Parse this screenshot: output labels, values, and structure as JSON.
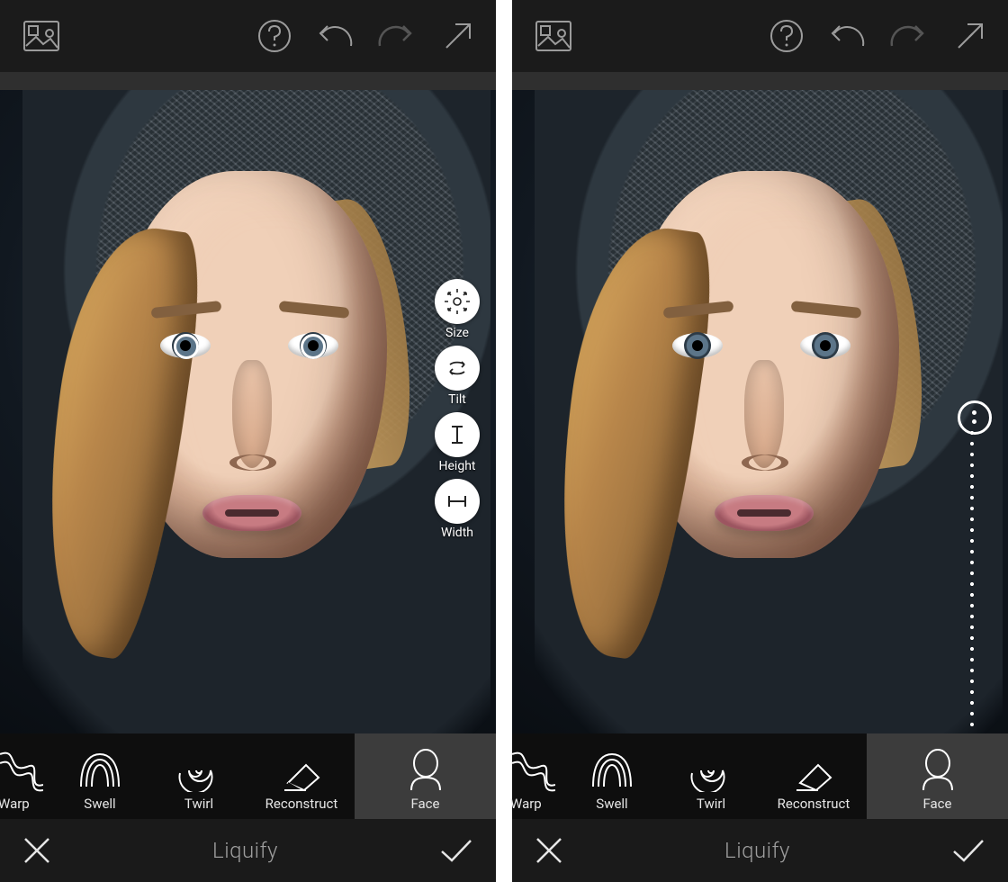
{
  "top": {
    "icons": [
      "compare-icon",
      "help-icon",
      "undo-icon",
      "redo-icon",
      "fullscreen-icon"
    ]
  },
  "faceTools": [
    {
      "id": "size",
      "label": "Size",
      "icon": "size-icon"
    },
    {
      "id": "tilt",
      "label": "Tilt",
      "icon": "tilt-icon"
    },
    {
      "id": "height",
      "label": "Height",
      "icon": "height-icon"
    },
    {
      "id": "width",
      "label": "Width",
      "icon": "width-icon"
    }
  ],
  "tools": [
    {
      "id": "warp",
      "label": "Warp",
      "icon": "warp-icon",
      "cropped": true
    },
    {
      "id": "swell",
      "label": "Swell",
      "icon": "swell-icon"
    },
    {
      "id": "twirl",
      "label": "Twirl",
      "icon": "twirl-icon"
    },
    {
      "id": "reconstruct",
      "label": "Reconstruct",
      "icon": "eraser-icon"
    },
    {
      "id": "face",
      "label": "Face",
      "icon": "face-icon",
      "selected": true
    }
  ],
  "confirm": {
    "title": "Liquify",
    "cancel": "cancel-icon",
    "ok": "confirm-icon"
  },
  "colors": {
    "accent": "#ffffff",
    "panel": "#1b1b1b",
    "selected": "#3c3c3c",
    "muted": "#9c9c9c"
  }
}
